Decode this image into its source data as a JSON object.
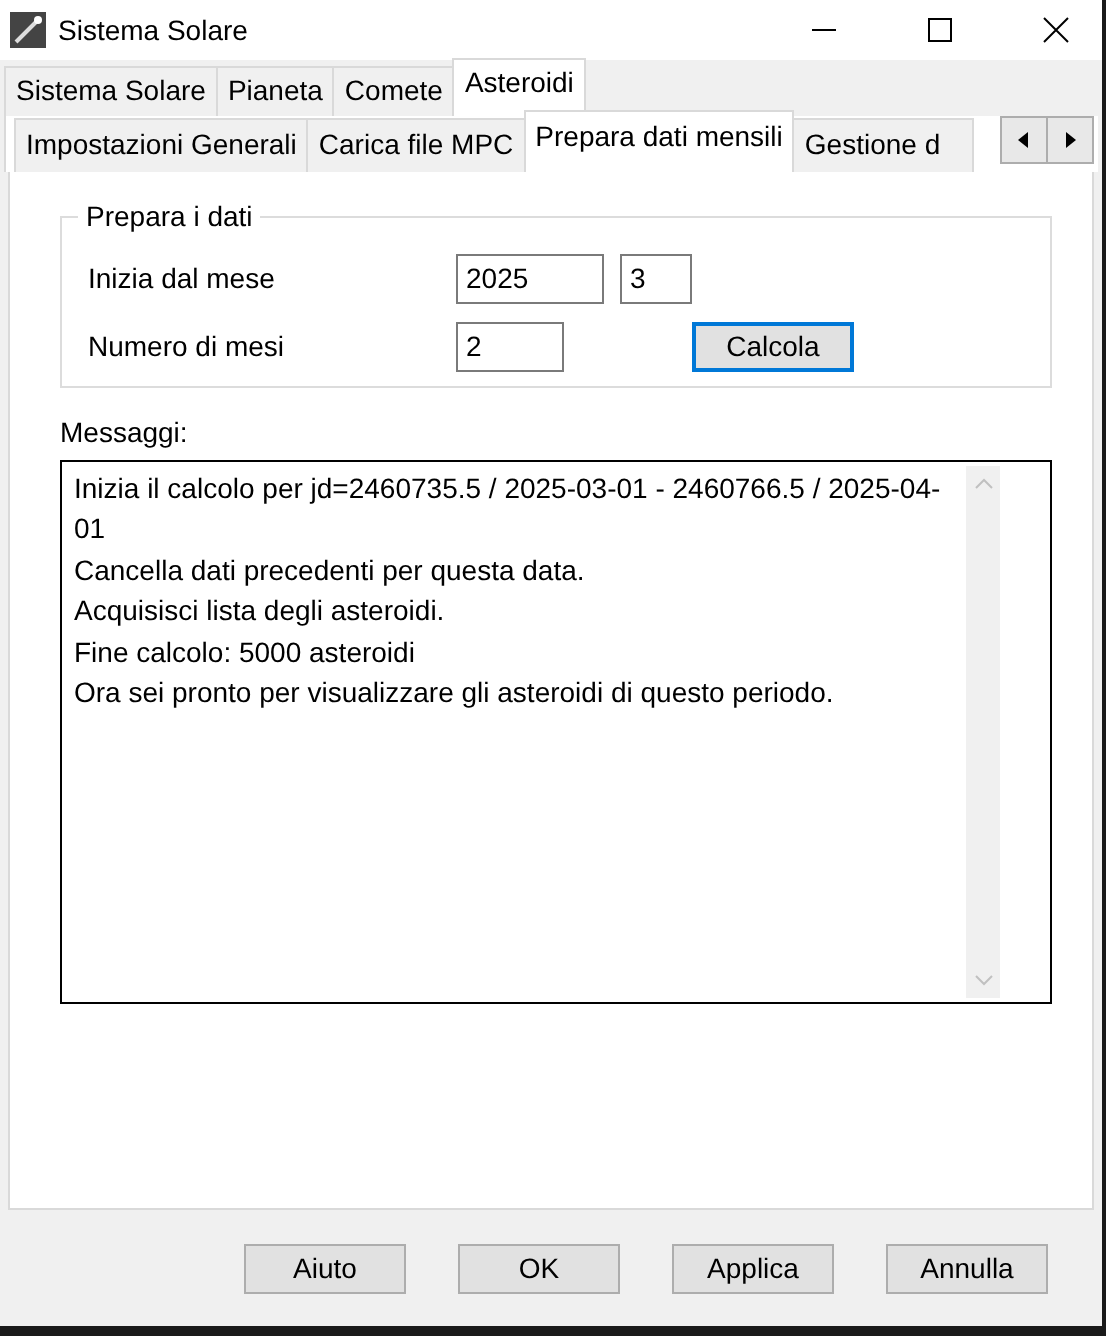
{
  "window": {
    "title": "Sistema Solare"
  },
  "tabs": [
    {
      "label": "Sistema Solare",
      "selected": false
    },
    {
      "label": "Pianeta",
      "selected": false
    },
    {
      "label": "Comete",
      "selected": false
    },
    {
      "label": "Asteroidi",
      "selected": true
    }
  ],
  "subtabs": [
    {
      "label": "Impostazioni Generali",
      "selected": false
    },
    {
      "label": "Carica file MPC",
      "selected": false
    },
    {
      "label": "Prepara dati mensili",
      "selected": true
    },
    {
      "label": "Gestione d",
      "selected": false
    }
  ],
  "group": {
    "title": "Prepara i dati",
    "start_label": "Inizia dal mese",
    "start_year": "2025",
    "start_month": "3",
    "count_label": "Numero di mesi",
    "count": "2",
    "calc_button": "Calcola"
  },
  "messages_label": "Messaggi:",
  "messages": [
    "Inizia il calcolo per jd=2460735.5 / 2025-03-01 - 2460766.5 / 2025-04-01",
    "Cancella dati precedenti per questa data.",
    "Acquisisci lista degli asteroidi.",
    "Fine calcolo: 5000 asteroidi",
    "Ora sei pronto per visualizzare gli asteroidi di questo periodo."
  ],
  "buttons": [
    "Aiuto",
    "OK",
    "Applica",
    "Annulla"
  ]
}
